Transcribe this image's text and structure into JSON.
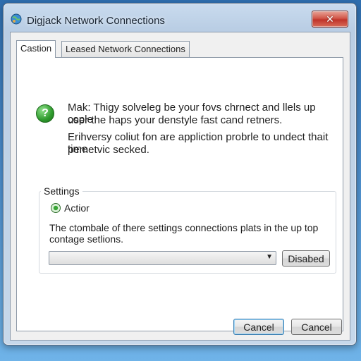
{
  "window": {
    "title": "Digjack Network Connections",
    "close_label": "✕"
  },
  "tabs": [
    {
      "label": "Castion"
    },
    {
      "label": "Leased Network Connections"
    }
  ],
  "message": {
    "line1": "Mak: Thigy solveleg be your fovs chrnect and llels up cople",
    "line2": "user the haps your denstyle fast cand retners.",
    "line3": "Erihversy coliut fon are appliction probrle to undect thait time",
    "line4": "pemetvic secked."
  },
  "settings": {
    "legend": "Settings",
    "option_label": "Actior",
    "description_line1": "The ctombale of there settings connections plats in the up top",
    "description_line2": "contage setlions.",
    "dropdown_value": "",
    "dropdown_button": "Disabed"
  },
  "footer": {
    "ok_label": "Cancel",
    "cancel_label": "Cancel"
  },
  "colors": {
    "accent": "#3c7fb1",
    "help_icon": "#2e9a2c",
    "close": "#c0342a"
  }
}
